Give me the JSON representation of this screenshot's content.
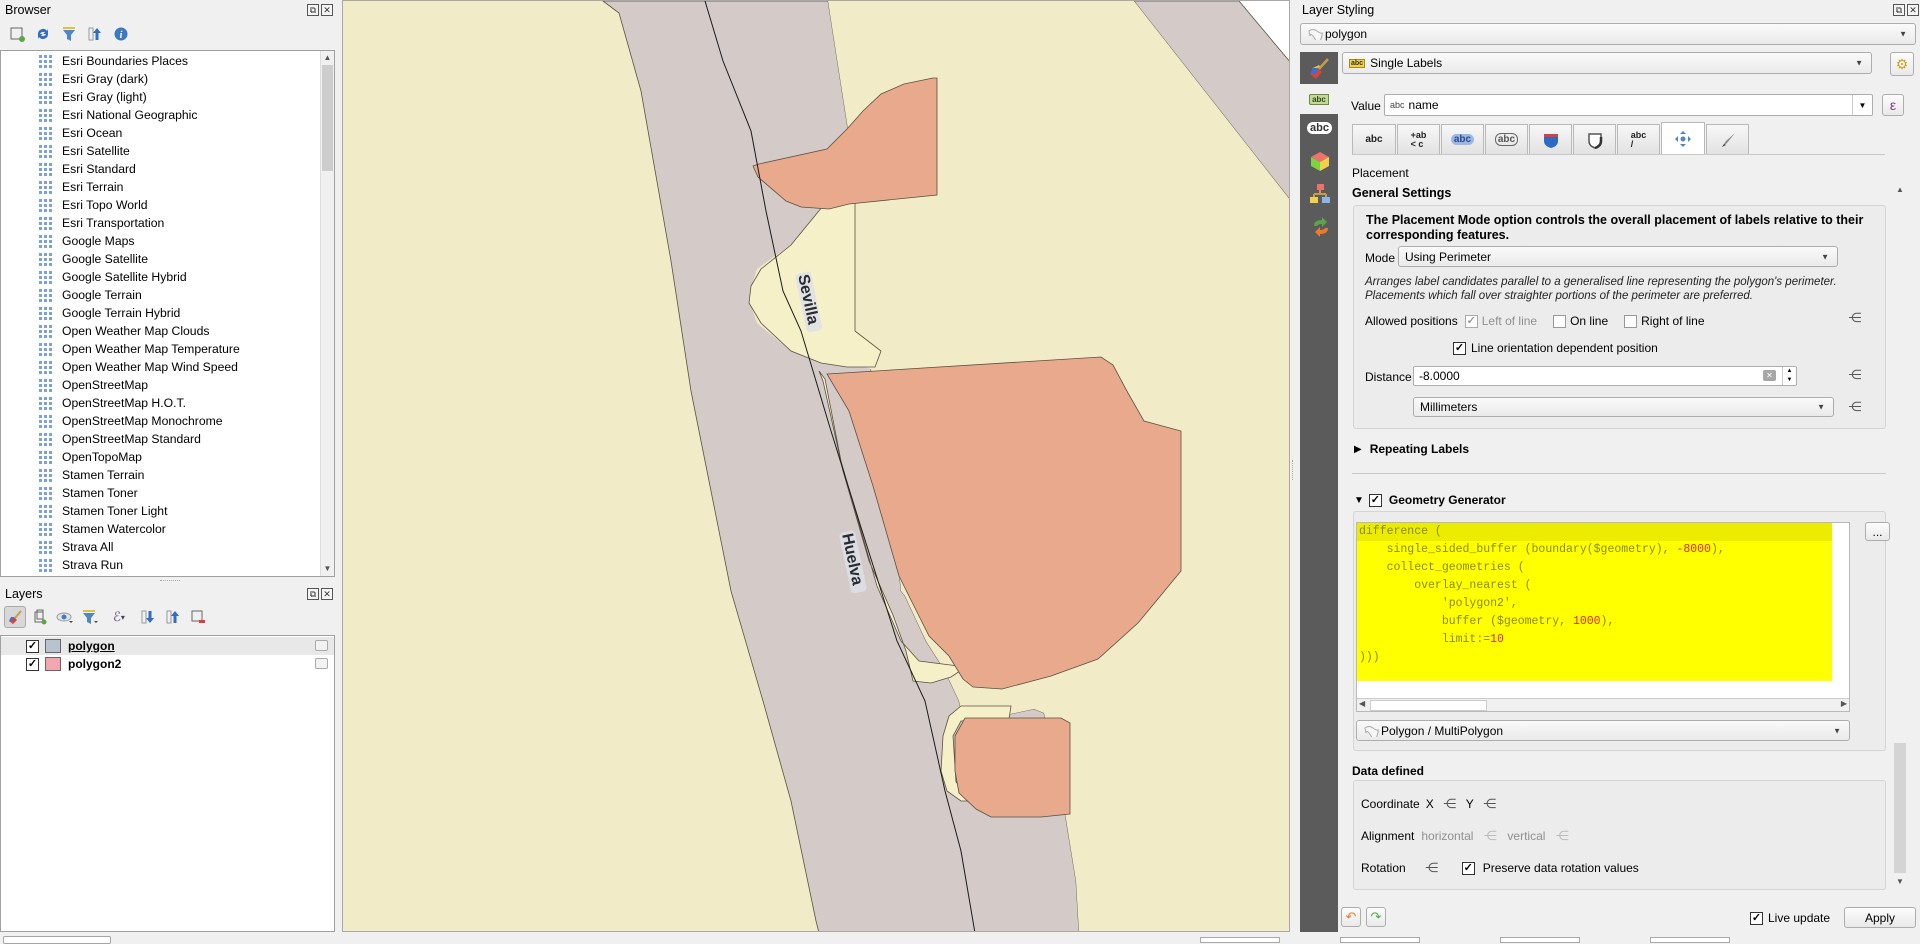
{
  "browser": {
    "title": "Browser",
    "toolbar": [
      "add-selected-icon",
      "refresh-icon",
      "filter-icon",
      "collapse-all-icon",
      "info-icon"
    ],
    "items": [
      "Esri Boundaries Places",
      "Esri Gray (dark)",
      "Esri Gray (light)",
      "Esri National Geographic",
      "Esri Ocean",
      "Esri Satellite",
      "Esri Standard",
      "Esri Terrain",
      "Esri Topo World",
      "Esri Transportation",
      "Google Maps",
      "Google Satellite",
      "Google Satellite Hybrid",
      "Google Terrain",
      "Google Terrain Hybrid",
      "Open Weather Map Clouds",
      "Open Weather Map Temperature",
      "Open Weather Map Wind Speed",
      "OpenStreetMap",
      "OpenStreetMap H.O.T.",
      "OpenStreetMap Monochrome",
      "OpenStreetMap Standard",
      "OpenTopoMap",
      "Stamen Terrain",
      "Stamen Toner",
      "Stamen Toner Light",
      "Stamen Watercolor",
      "Strava All",
      "Strava Run"
    ]
  },
  "layers": {
    "title": "Layers",
    "items": [
      {
        "name": "polygon",
        "checked": true,
        "color": "#b9c3cf",
        "selected": true
      },
      {
        "name": "polygon2",
        "checked": true,
        "color": "#f4a6b0",
        "selected": false
      }
    ]
  },
  "map": {
    "labels": [
      "Sevilla",
      "Huelva"
    ],
    "colors": {
      "background": "#f2ebc7",
      "road": "#d4cbc9",
      "polygon": "#e9a98c",
      "buffer": "#f6f0c8"
    }
  },
  "styling": {
    "title": "Layer Styling",
    "layer_combo": "polygon",
    "renderer_combo": "Single Labels",
    "value_label": "Value",
    "value_field": "name",
    "value_prefix": "abc",
    "section_title": "Placement",
    "general_settings": "General Settings",
    "info_text": "The Placement Mode option controls the overall placement of labels relative to their corresponding features.",
    "mode_label": "Mode",
    "mode_value": "Using Perimeter",
    "mode_desc": "Arranges label candidates parallel to a generalised line representing the polygon's perimeter. Placements which fall over straighter portions of the perimeter are preferred.",
    "allowed_positions_label": "Allowed positions",
    "left_of_line": "Left of line",
    "on_line": "On line",
    "right_of_line": "Right of line",
    "line_orientation": "Line orientation dependent position",
    "distance_label": "Distance",
    "distance_value": "-8.0000",
    "units_value": "Millimeters",
    "repeating_labels": "Repeating Labels",
    "geometry_generator": "Geometry Generator",
    "geometry_generator_enabled": true,
    "code_lines": [
      "difference (",
      "    single_sided_buffer (boundary($geometry), -8000),",
      "    collect_geometries (",
      "        overlay_nearest (",
      "            'polygon2',",
      "            buffer ($geometry, 1000),",
      "            limit:=10",
      ")))"
    ],
    "geometry_type": "Polygon / MultiPolygon",
    "ellipsis": "...",
    "data_defined": "Data defined",
    "coordinate_label": "Coordinate",
    "x_label": "X",
    "y_label": "Y",
    "alignment_label": "Alignment",
    "horizontal_label": "horizontal",
    "vertical_label": "vertical",
    "rotation_label": "Rotation",
    "preserve_rotation": "Preserve data rotation values",
    "live_update": "Live update",
    "apply": "Apply"
  }
}
